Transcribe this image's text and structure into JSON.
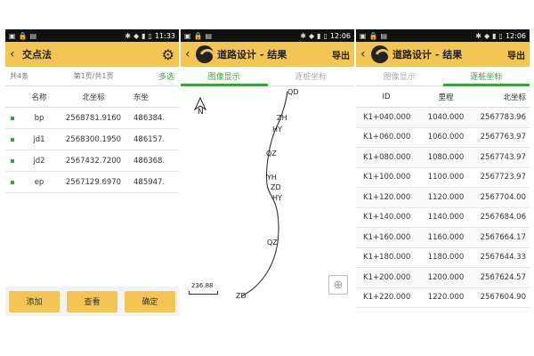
{
  "panel1": {
    "status": {
      "time": "11:33"
    },
    "title": "交点法",
    "info": {
      "count": "共4条",
      "page": "第1页/共1页",
      "multi": "多选"
    },
    "columns": {
      "name": "名称",
      "north": "北坐标",
      "east": "东坐"
    },
    "rows": [
      {
        "name": "bp",
        "north": "2568781.9160",
        "east": "486384."
      },
      {
        "name": "jd1",
        "north": "2568300.1950",
        "east": "486157."
      },
      {
        "name": "jd2",
        "north": "2567432.7200",
        "east": "486368."
      },
      {
        "name": "ep",
        "north": "2567129.6970",
        "east": "485947."
      }
    ],
    "buttons": {
      "add": "添加",
      "view": "查看",
      "ok": "确定"
    }
  },
  "panel2": {
    "status": {
      "time": "12:06"
    },
    "title": "道路设计 - 结果",
    "export": "导出",
    "tabs": {
      "graphic": "图像显示",
      "stake": "逐桩坐标"
    },
    "north_label": "N",
    "scale": "236.88",
    "labels": [
      "QD",
      "ZH",
      "HY",
      "QZ",
      "YH",
      "ZD",
      "HY",
      "QZ",
      "ZD"
    ]
  },
  "panel3": {
    "status": {
      "time": "12:06"
    },
    "title": "道路设计 - 结果",
    "export": "导出",
    "tabs": {
      "graphic": "图像显示",
      "stake": "逐桩坐标"
    },
    "columns": {
      "id": "ID",
      "mileage": "里程",
      "north": "北坐标"
    },
    "rows": [
      {
        "id": "K1+040.000",
        "mileage": "1040.000",
        "north": "2567783.96"
      },
      {
        "id": "K1+060.000",
        "mileage": "1060.000",
        "north": "2567763.97"
      },
      {
        "id": "K1+080.000",
        "mileage": "1080.000",
        "north": "2567743.97"
      },
      {
        "id": "K1+100.000",
        "mileage": "1100.000",
        "north": "2567723.97"
      },
      {
        "id": "K1+120.000",
        "mileage": "1120.000",
        "north": "2567704.00"
      },
      {
        "id": "K1+140.000",
        "mileage": "1140.000",
        "north": "2567684.06"
      },
      {
        "id": "K1+160.000",
        "mileage": "1160.000",
        "north": "2567664.17"
      },
      {
        "id": "K1+180.000",
        "mileage": "1180.000",
        "north": "2567644.33"
      },
      {
        "id": "K1+200.000",
        "mileage": "1200.000",
        "north": "2567624.57"
      },
      {
        "id": "K1+220.000",
        "mileage": "1220.000",
        "north": "2567604.90"
      }
    ]
  }
}
